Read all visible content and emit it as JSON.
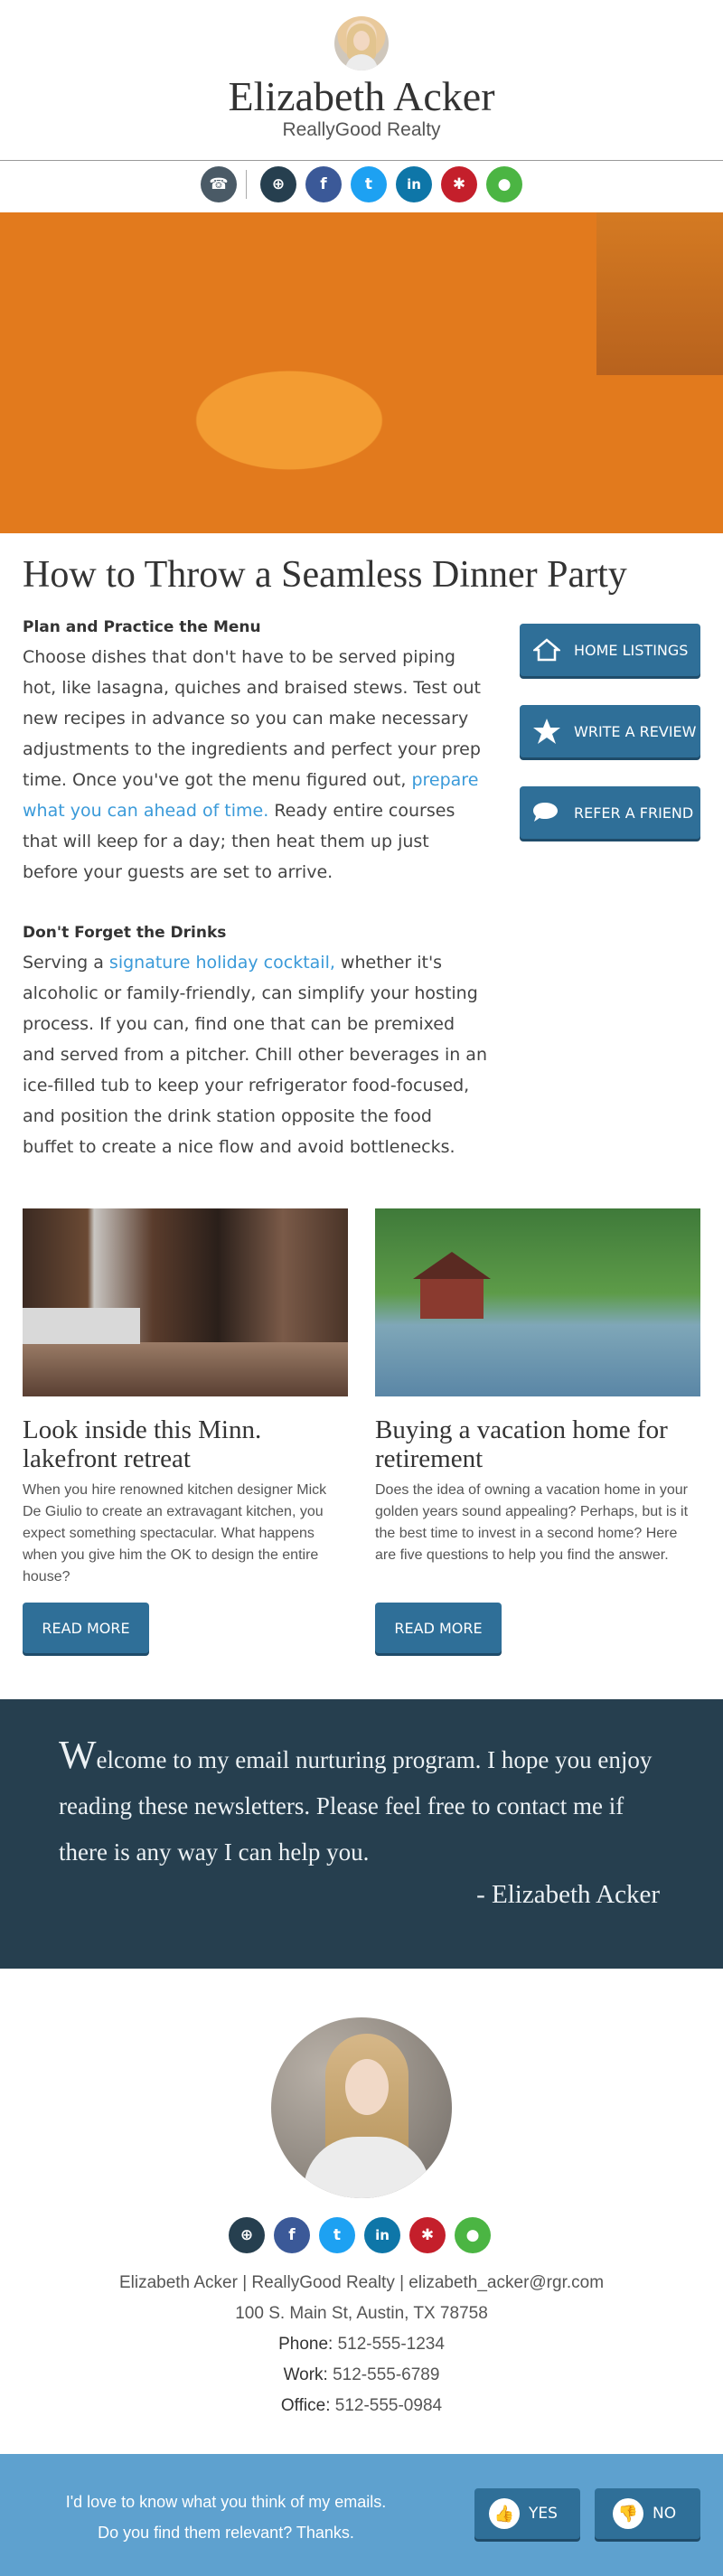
{
  "header": {
    "name": "Elizabeth Acker",
    "company": "ReallyGood Realty"
  },
  "colors": {
    "accent_button": "#2f6f98",
    "link": "#3a9ad9",
    "quote_band": "#263f4f",
    "feedback_band": "#5ea1cf"
  },
  "social_top": [
    {
      "icon": "phone-icon",
      "color": "#4a5a66",
      "glyph": "☎"
    },
    {
      "icon": "globe-icon",
      "color": "#263f4f",
      "glyph": "⊕"
    },
    {
      "icon": "facebook-icon",
      "color": "#3b5998",
      "glyph": "f"
    },
    {
      "icon": "twitter-icon",
      "color": "#1da1f2",
      "glyph": "t"
    },
    {
      "icon": "linkedin-icon",
      "color": "#0e76a8",
      "glyph": "in"
    },
    {
      "icon": "yelp-icon",
      "color": "#c41f2b",
      "glyph": "✱"
    },
    {
      "icon": "map-pin-icon",
      "color": "#4bb543",
      "glyph": "●"
    }
  ],
  "article": {
    "title": "How to Throw a Seamless Dinner Party",
    "section1": {
      "heading": "Plan and Practice the Menu",
      "text_before": "Choose dishes that don't have to be served piping hot, like lasagna, quiches and braised stews. Test out new recipes in advance so you can make necessary adjustments to the ingredients and perfect your prep time. Once you've got the menu figured out, ",
      "link": "prepare what you can ahead of time.",
      "text_after": " Ready entire courses that will keep for a day; then heat them up just before your guests are set to arrive."
    },
    "section2": {
      "heading": "Don't Forget the Drinks",
      "text_before": "Serving a ",
      "link": "signature holiday cocktail,",
      "text_after": " whether it's alcoholic or family-friendly, can simplify your hosting process. If you can, find one that can be premixed and served from a pitcher. Chill other beverages in an ice-filled tub to keep your refrigerator food-focused, and position the drink station opposite the food buffet to create a nice flow and avoid bottlenecks."
    }
  },
  "side_buttons": [
    {
      "label": "HOME LISTINGS",
      "icon": "home-icon"
    },
    {
      "label": "WRITE A REVIEW",
      "icon": "star-icon"
    },
    {
      "label": "REFER A FRIEND",
      "icon": "chat-bubble-icon"
    }
  ],
  "cards": [
    {
      "title": "Look inside this Minn. lakefront retreat",
      "text": "When you hire renowned kitchen designer Mick De Giulio to create an extravagant kitchen, you expect something spectacular. What happens when you give him the OK to design the entire house?",
      "button": "READ MORE"
    },
    {
      "title": "Buying a vacation home for retirement",
      "text": "Does the idea of owning a vacation home in your golden years sound appealing? Perhaps, but is it the best time to invest in a second home? Here are five questions to help you find the answer.",
      "button": "READ MORE"
    }
  ],
  "quote": {
    "first_letter": "W",
    "rest": "elcome to my email nurturing program. I hope you enjoy reading these newsletters. Please feel free to contact me if there is any way I can help you.",
    "signature": "- Elizabeth Acker"
  },
  "social_bottom": [
    {
      "icon": "globe-icon",
      "color": "#263f4f",
      "glyph": "⊕"
    },
    {
      "icon": "facebook-icon",
      "color": "#3b5998",
      "glyph": "f"
    },
    {
      "icon": "twitter-icon",
      "color": "#1da1f2",
      "glyph": "t"
    },
    {
      "icon": "linkedin-icon",
      "color": "#0e76a8",
      "glyph": "in"
    },
    {
      "icon": "yelp-icon",
      "color": "#c41f2b",
      "glyph": "✱"
    },
    {
      "icon": "map-pin-icon",
      "color": "#4bb543",
      "glyph": "●"
    }
  ],
  "contact": {
    "line1": "Elizabeth Acker  |  ReallyGood Realty  |  elizabeth_acker@rgr.com",
    "address": "100 S. Main St, Austin, TX 78758",
    "phone_label": "Phone:",
    "phone": "512-555-1234",
    "work_label": "Work:",
    "work": "512-555-6789",
    "office_label": "Office:",
    "office": "512-555-0984"
  },
  "feedback": {
    "line1": "I'd love to know what you think of my emails.",
    "line2": "Do you find them relevant? Thanks.",
    "yes": "YES",
    "no": "NO"
  }
}
